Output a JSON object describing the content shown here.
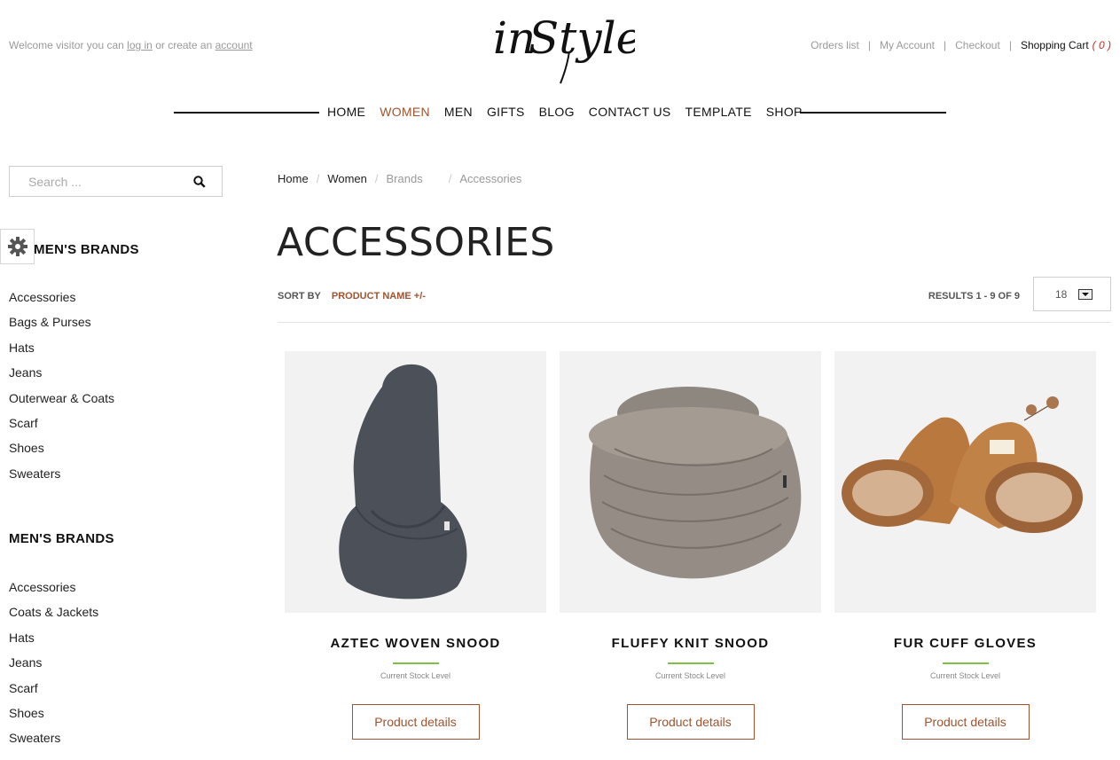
{
  "header": {
    "welcome_prefix": "Welcome visitor you can",
    "login_label": "log in",
    "welcome_middle": "or create an",
    "account_label": "account",
    "logo_text": "inStyle",
    "links": [
      "Orders list",
      "My Account",
      "Checkout"
    ],
    "cart_label": "Shopping Cart",
    "cart_count": "( 0 )"
  },
  "nav": {
    "items": [
      "HOME",
      "WOMEN",
      "MEN",
      "GIFTS",
      "BLOG",
      "CONTACT US",
      "TEMPLATE",
      "SHOP"
    ],
    "active": "WOMEN"
  },
  "sidebar": {
    "search_placeholder": "Search ...",
    "sections": [
      {
        "title": "MEN'S BRANDS",
        "items": [
          "Accessories",
          "Bags & Purses",
          "Hats",
          "Jeans",
          "Outerwear & Coats",
          "Scarf",
          "Shoes",
          "Sweaters"
        ]
      },
      {
        "title": "MEN'S BRANDS",
        "items": [
          "Accessories",
          "Coats & Jackets",
          "Hats",
          "Jeans",
          "Scarf",
          "Shoes",
          "Sweaters"
        ]
      }
    ]
  },
  "breadcrumb": [
    "Home",
    "Women",
    "Brands",
    "Accessories"
  ],
  "page": {
    "title": "ACCESSORIES",
    "sort_label": "SORT BY",
    "sort_value": "PRODUCT NAME +/-",
    "results": "RESULTS 1 - 9 OF 9",
    "per_page": "18"
  },
  "products": [
    {
      "name": "AZTEC WOVEN SNOOD",
      "stock_label": "Current Stock Level",
      "button": "Product details",
      "image": "grey-hooded-snood"
    },
    {
      "name": "FLUFFY KNIT SNOOD",
      "stock_label": "Current Stock Level",
      "button": "Product details",
      "image": "knit-snood"
    },
    {
      "name": "FUR CUFF GLOVES",
      "stock_label": "Current Stock Level",
      "button": "Product details",
      "image": "fur-cuff-mittens"
    }
  ],
  "colors": {
    "accent": "#a0532e",
    "stock_green": "#7cc242",
    "cart_count": "#b5332a"
  }
}
